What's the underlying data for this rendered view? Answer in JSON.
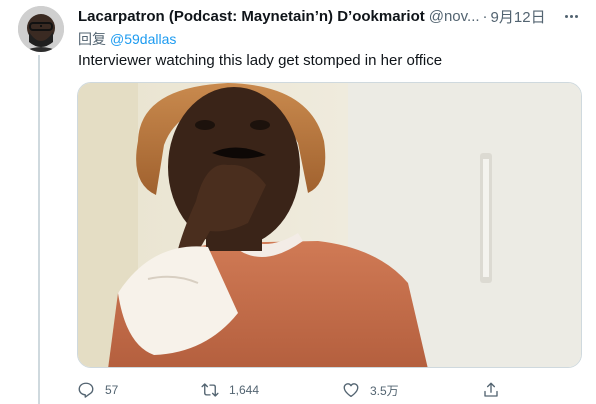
{
  "tweet": {
    "author": {
      "display_name": "Lacarpatron (Podcast: Maynetain’n) D’ookmariot",
      "handle": "@nov...",
      "separator": "·",
      "timestamp": "9月12日"
    },
    "reply_to": {
      "label": "回复",
      "mention": "@59dallas"
    },
    "text": "Interviewer watching this lady get stomped in her office",
    "actions": {
      "reply_count": "57",
      "retweet_count": "1,644",
      "like_count": "3.5万"
    }
  },
  "colors": {
    "text_primary": "#0f1419",
    "text_secondary": "#536471",
    "link": "#1d9bf0",
    "border": "#cfd9de"
  },
  "icons": {
    "reply": "reply-icon",
    "retweet": "retweet-icon",
    "like": "heart-icon",
    "share": "share-icon",
    "more": "more-icon"
  }
}
